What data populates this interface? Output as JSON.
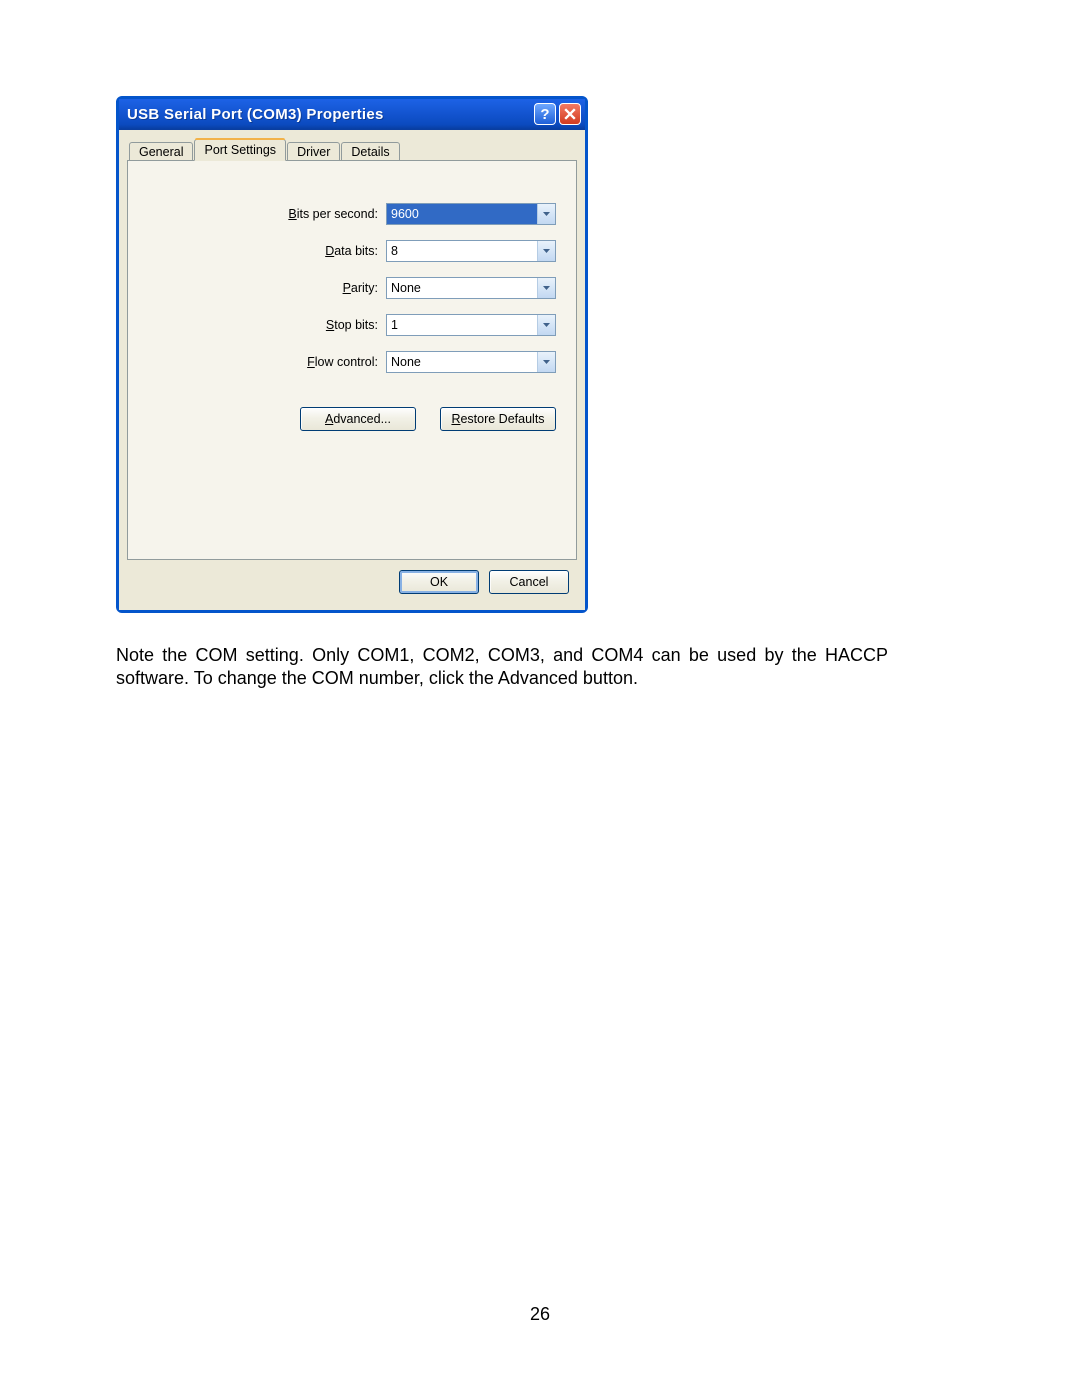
{
  "dialog": {
    "title": "USB Serial Port (COM3) Properties",
    "tabs": [
      "General",
      "Port Settings",
      "Driver",
      "Details"
    ],
    "active_tab_index": 1,
    "fields": {
      "bps": {
        "label_pre": "B",
        "label_rest": "its per second:",
        "value": "9600"
      },
      "data": {
        "label_pre": "D",
        "label_rest": "ata bits:",
        "value": "8"
      },
      "parity": {
        "label_pre": "P",
        "label_rest": "arity:",
        "value": "None"
      },
      "stop": {
        "label_pre": "S",
        "label_rest": "top bits:",
        "value": "1"
      },
      "flow": {
        "label_pre": "F",
        "label_rest": "low control:",
        "value": "None"
      }
    },
    "buttons": {
      "advanced_pre": "A",
      "advanced_rest": "dvanced...",
      "restore_pre": "R",
      "restore_rest": "estore Defaults",
      "ok": "OK",
      "cancel": "Cancel"
    }
  },
  "caption": "Note the COM setting. Only COM1, COM2, COM3, and COM4 can be used by the HACCP software. To change the COM number, click the Advanced button.",
  "page_number": "26"
}
